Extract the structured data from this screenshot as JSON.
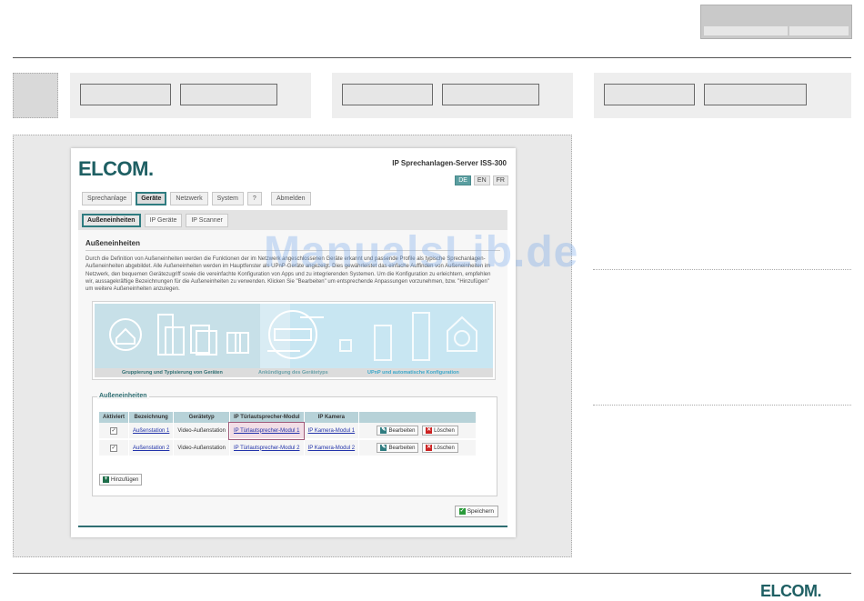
{
  "app": {
    "brand": "ELCOM.",
    "product_title": "IP Sprechanlagen-Server ISS-300",
    "languages": [
      "DE",
      "EN",
      "FR"
    ],
    "active_language": "DE"
  },
  "nav": {
    "tabs": [
      "Sprechanlage",
      "Geräte",
      "Netzwerk",
      "System",
      "?"
    ],
    "active_tab": "Geräte",
    "logout": "Abmelden"
  },
  "subnav": {
    "tabs": [
      "Außeneinheiten",
      "IP Geräte",
      "IP Scanner"
    ],
    "active_tab": "Außeneinheiten"
  },
  "section": {
    "title": "Außeneinheiten",
    "description": "Durch die Definition von Außeneinheiten werden die Funktionen der im Netzwerk angeschlossenen Geräte erkannt und passende Profile als typische Sprechanlagen-Außeneinheiten abgebildet. Alle Außeneinheiten werden im Hauptfenster als UPnP-Geräte angezeigt. Dies gewährleistet das einfache Auffinden von Außeneinheiten im Netzwerk, den bequemen Gerätezugriff sowie die vereinfachte Konfiguration von Apps und zu integrierenden Systemen. Um die Konfiguration zu erleichtern, empfehlen wir, aussagekräftige Bezeichnungen für die Außeneinheiten zu verwenden. Klicken Sie \"Bearbeiten\" um entsprechende Anpassungen vorzunehmen, bzw. \"Hinzufügen\" um weitere Außeneinheiten anzulegen."
  },
  "illustration": {
    "captions": [
      "Gruppierung und Typisierung von Geräten",
      "Ankündigung des Gerätetyps",
      "UPnP und automatische Konfiguration"
    ]
  },
  "devices": {
    "legend": "Außeneinheiten",
    "columns": [
      "Aktiviert",
      "Bezeichnung",
      "Gerätetyp",
      "IP Türlautsprecher-Modul",
      "IP Kamera"
    ],
    "rows": [
      {
        "checked": "✓",
        "name": "Außenstation 1",
        "type": "Video-Außenstation",
        "speaker": "IP Türlautsprecher-Modul 1",
        "camera": "IP Kamera-Modul 1"
      },
      {
        "checked": "✓",
        "name": "Außenstation 2",
        "type": "Video-Außenstation",
        "speaker": "IP Türlautsprecher-Modul 2",
        "camera": "IP Kamera-Modul 2"
      }
    ],
    "edit_label": "Bearbeiten",
    "delete_label": "Löschen",
    "add_label": "Hinzufügen"
  },
  "footer": {
    "save_label": "Speichern"
  },
  "page": {
    "watermark": "ManualsLib.de",
    "bottom_brand": "ELCOM."
  },
  "colors": {
    "brand": "#1e5f63",
    "accent": "#2f7c80",
    "table_header": "#b7d2d8",
    "link": "#2233aa",
    "delete": "#cc2222"
  }
}
